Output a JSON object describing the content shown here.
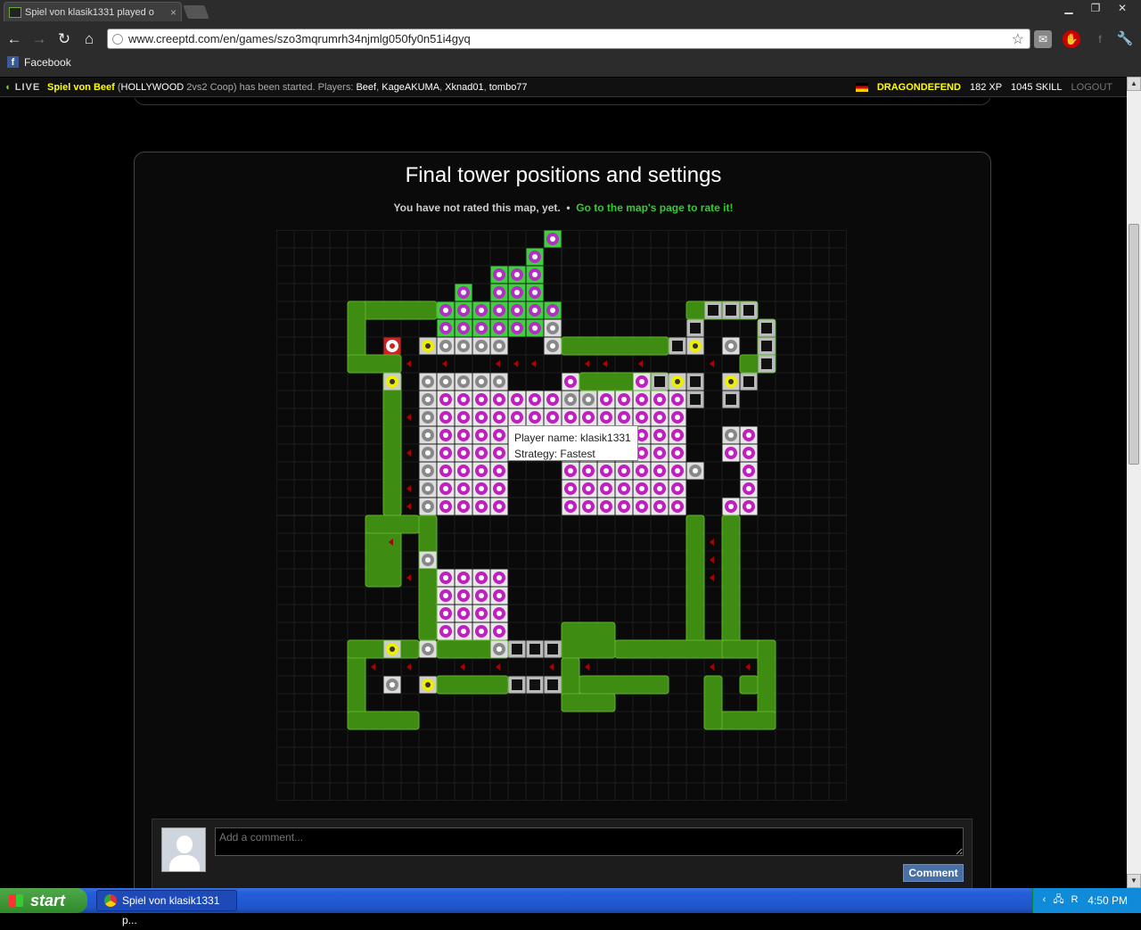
{
  "browser": {
    "tab_title": "Spiel von klasik1331 played o",
    "tab_close": "×",
    "url": "www.creeptd.com/en/games/szo3mqrumrh34njmlg050fy0n51i4gyq",
    "bookmark_label": "Facebook",
    "icons": [
      "back-icon",
      "forward-icon",
      "reload-icon",
      "home-icon",
      "star-icon",
      "gmail-icon",
      "adblock-icon",
      "facebook-icon",
      "wrench-icon"
    ]
  },
  "livebar": {
    "logo": "LIVE",
    "game_name": "Spiel von Beef",
    "game_info_open": "(",
    "game_mode": "HOLLYWOOD",
    "game_type": "2vs2 Coop) has been started. Players:",
    "players": [
      "Beef",
      "KageAKUMA",
      "Xknad01",
      "tombo77"
    ],
    "user": "DRAGONDEFEND",
    "xp": "182 XP",
    "skill": "1045 SKILL",
    "logout": "LOGOUT"
  },
  "main": {
    "title": "Final tower positions and settings",
    "rate_text": "You have not rated this map, yet.",
    "rate_sep": "•",
    "rate_link": "Go to the map's page to rate it!"
  },
  "tooltip": {
    "player_line": "Player name: klasik1331",
    "strategy_line": "Strategy: Fastest"
  },
  "comment": {
    "placeholder": "Add a comment...",
    "button": "Comment"
  },
  "taskbar": {
    "start": "start",
    "task": "Spiel von klasik1331 p...",
    "time": "4:50 PM"
  },
  "colors": {
    "accent_green": "#33cc33",
    "live_yellow": "#ffff00",
    "path_green": "#3f8c12",
    "tower_pink": "#c020c0"
  }
}
